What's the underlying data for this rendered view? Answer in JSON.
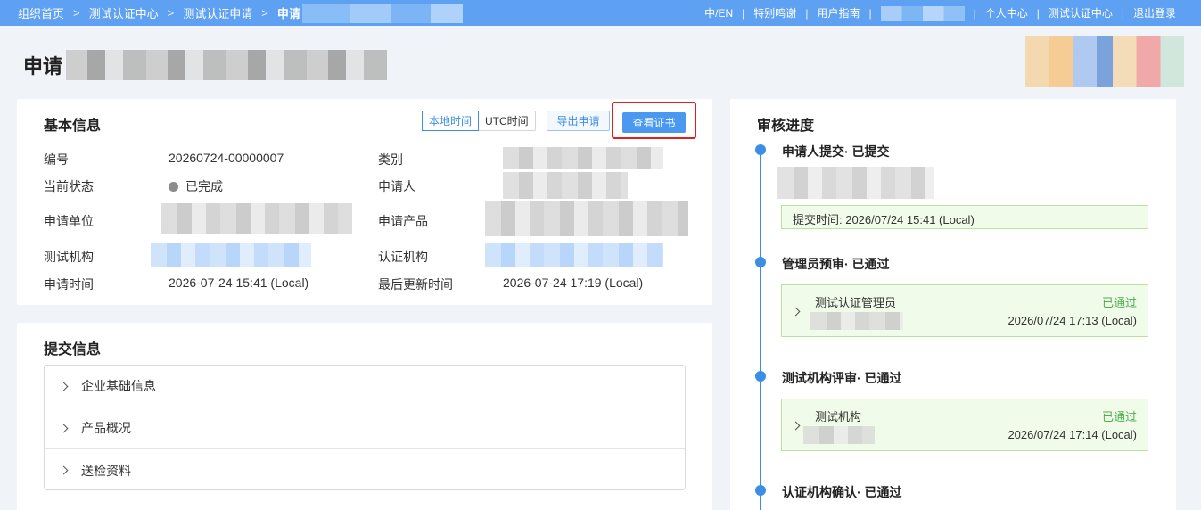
{
  "topbar": {
    "breadcrumbs": [
      "组织首页",
      "测试认证中心",
      "测试认证申请",
      "申请"
    ],
    "links": [
      "中/EN",
      "特别鸣谢",
      "用户指南",
      "个人中心",
      "测试认证中心",
      "退出登录"
    ]
  },
  "page": {
    "title": "申请"
  },
  "basic": {
    "title": "基本信息",
    "time_local": "本地时间",
    "time_utc": "UTC时间",
    "export": "导出申请",
    "view_cert": "查看证书",
    "labels": {
      "number": "编号",
      "status": "当前状态",
      "org": "申请单位",
      "test_org": "测试机构",
      "apply_time": "申请时间",
      "category": "类别",
      "applicant": "申请人",
      "product": "申请产品",
      "cert_org": "认证机构",
      "updated": "最后更新时间"
    },
    "values": {
      "number": "20260724-00000007",
      "status": "已完成",
      "apply_time": "2026-07-24 15:41 (Local)",
      "updated": "2026-07-24 17:19 (Local)"
    }
  },
  "submit": {
    "title": "提交信息",
    "items": [
      "企业基础信息",
      "产品概况",
      "送检资料"
    ]
  },
  "progress": {
    "title": "审核进度",
    "steps": [
      {
        "label": "申请人提交· 已提交",
        "time": "提交时间:  2026/07/24 15:41 (Local)"
      },
      {
        "label": "管理员预审· 已通过",
        "role": "测试认证管理员",
        "state": "已通过",
        "date": "2026/07/24 17:13 (Local)"
      },
      {
        "label": "测试机构评审· 已通过",
        "role": "测试机构",
        "state": "已通过",
        "date": "2026/07/24 17:14 (Local)"
      },
      {
        "label": "认证机构确认· 已通过"
      }
    ]
  },
  "colors": {
    "topbar": "#5ea0f2",
    "accent": "#3a8ee6",
    "success": "#4caf50",
    "highlight": "#e02020"
  }
}
